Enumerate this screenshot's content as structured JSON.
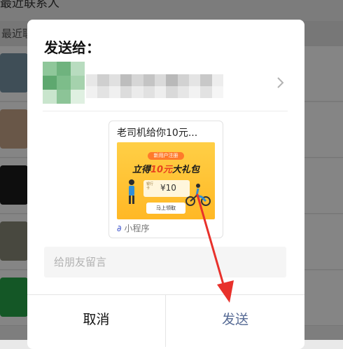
{
  "background": {
    "header_text": "最近联系人",
    "section_label": "最近联",
    "rows": [
      {
        "thumb": "#7a96a8"
      },
      {
        "thumb": "#c9a88a"
      },
      {
        "thumb": "#1b1b1b"
      },
      {
        "thumb": "#8a8a7a"
      },
      {
        "thumb": "#27a84a"
      }
    ]
  },
  "dialog": {
    "title": "发送给：",
    "card": {
      "title": "老司机给你10元...",
      "image": {
        "pill": "新用户注册",
        "headline_pre": "立得",
        "headline_hl": "10元",
        "headline_post": "大礼包",
        "coupon_tag": "银行卡",
        "coupon_amount": "¥10",
        "claim_button": "马上领取"
      },
      "footer_icon": "mini-program-icon",
      "footer_label": "小程序"
    },
    "message_placeholder": "给朋友留言",
    "cancel_label": "取消",
    "send_label": "发送"
  },
  "colors": {
    "send_link": "#576b95",
    "arrow": "#e8312b",
    "card_bg": "#ffc636"
  }
}
